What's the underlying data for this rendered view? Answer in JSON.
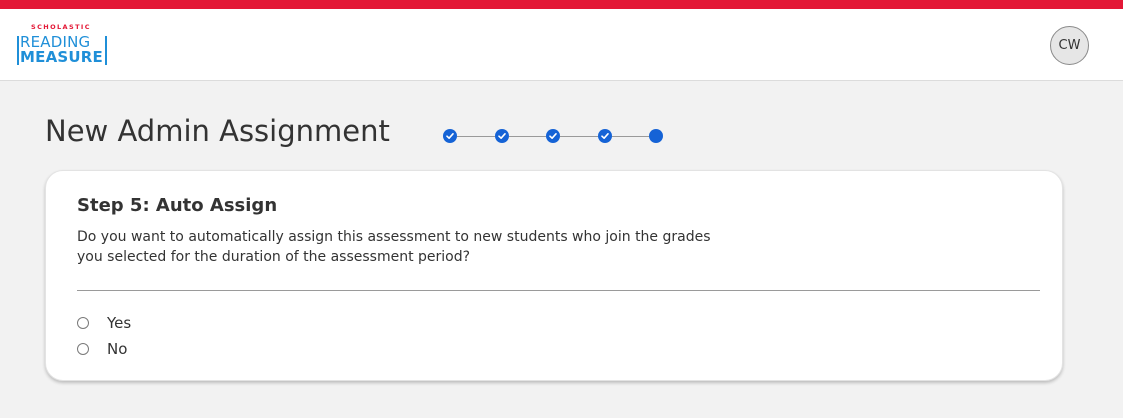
{
  "brand": {
    "company": "SCHOLASTIC",
    "product_line1": "READING",
    "product_line2": "MEASURE"
  },
  "user": {
    "initials": "CW"
  },
  "page": {
    "title": "New Admin Assignment"
  },
  "stepper": {
    "total_steps": 5,
    "completed_steps": 4,
    "current_step": 5
  },
  "step": {
    "title": "Step 5: Auto Assign",
    "description": "Do you want to automatically assign this assessment to new students who join the grades you selected for the duration of the assessment period?"
  },
  "options": [
    {
      "label": "Yes",
      "selected": false
    },
    {
      "label": "No",
      "selected": false
    }
  ],
  "colors": {
    "accent_red": "#e31836",
    "brand_blue": "#1f8fd8",
    "step_blue": "#1563d6"
  }
}
